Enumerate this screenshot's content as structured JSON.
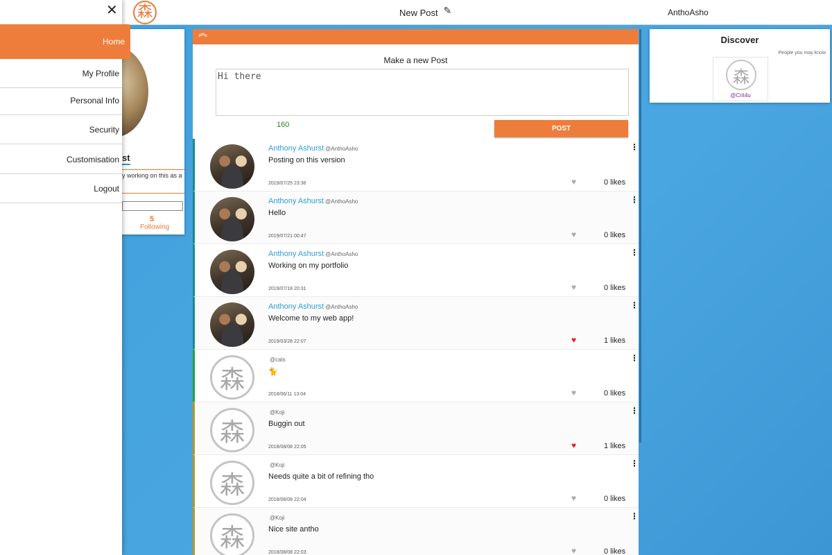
{
  "topbar": {
    "logo_glyph": "森",
    "new_post_label": "New Post",
    "pencil_icon": "✎",
    "username": "AnthoAsho"
  },
  "profile_card": {
    "name_fragment": "st",
    "bio_fragment": "y working on this as a",
    "following_count": "5",
    "following_label": "Following"
  },
  "drawer": {
    "close_icon": "✕",
    "items": [
      {
        "label": "Home",
        "active": true
      },
      {
        "label": "My Profile"
      },
      {
        "label": "Personal Info"
      },
      {
        "label": "Security"
      },
      {
        "label": "Customisation"
      },
      {
        "label": "Logout"
      }
    ]
  },
  "composer": {
    "collapse_icon": "︽",
    "title": "Make a new Post",
    "value": "Hi there",
    "char_count": "160",
    "post_label": "POST"
  },
  "posts": [
    {
      "name": "Anthony Ashurst",
      "handle": "@AnthoAsho",
      "text": "Posting on this version",
      "date": "2019/07/25 23:36",
      "likes": "0 likes",
      "liked": false,
      "avatar": "photo",
      "accent": "#1a8a8a"
    },
    {
      "name": "Anthony Ashurst",
      "handle": "@AnthoAsho",
      "text": "Hello",
      "date": "2019/07/21 00:47",
      "likes": "0 likes",
      "liked": false,
      "avatar": "photo",
      "accent": "#1a8a8a"
    },
    {
      "name": "Anthony Ashurst",
      "handle": "@AnthoAsho",
      "text": "Working on my portfolio",
      "date": "2019/07/18 20:31",
      "likes": "0 likes",
      "liked": false,
      "avatar": "photo",
      "accent": "#1a8a8a"
    },
    {
      "name": "Anthony Ashurst",
      "handle": "@AnthoAsho",
      "text": "Welcome to my web app!",
      "date": "2019/03/28 22:07",
      "likes": "1 likes",
      "liked": true,
      "avatar": "photo",
      "accent": "#1a8a8a"
    },
    {
      "name": "",
      "handle": "@cats",
      "text": "🐈",
      "date": "2018/06/11 13:04",
      "likes": "0 likes",
      "liked": false,
      "avatar": "kanji",
      "accent": "#2a9d3c"
    },
    {
      "name": "",
      "handle": "@Koji",
      "text": "Buggin out",
      "date": "2018/08/08 22:05",
      "likes": "1 likes",
      "liked": true,
      "avatar": "kanji",
      "accent": "#b39a1a"
    },
    {
      "name": "",
      "handle": "@Koji",
      "text": "Needs quite a bit of refining tho",
      "date": "2018/08/08 22:04",
      "likes": "0 likes",
      "liked": false,
      "avatar": "kanji",
      "accent": "#b39a1a"
    },
    {
      "name": "",
      "handle": "@Koji",
      "text": "Nice site antho",
      "date": "2018/08/08 22:03",
      "likes": "0 likes",
      "liked": false,
      "avatar": "kanji",
      "accent": "#b39a1a"
    }
  ],
  "icons": {
    "heart": "♥",
    "menu": "⋮",
    "kanji": "森"
  },
  "discover": {
    "title": "Discover",
    "subtitle": "People you may know",
    "suggestion_handle": "@Crit4u"
  },
  "colors": {
    "brand_orange": "#ee7d3b",
    "link_blue": "#2a9fd6",
    "background_blue": "#3fa0dc",
    "like_red": "#e52222"
  }
}
